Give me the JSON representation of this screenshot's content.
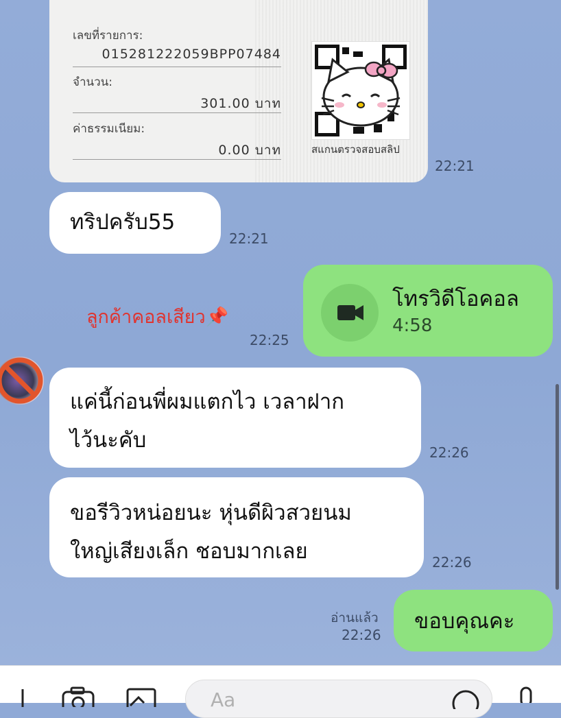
{
  "slip": {
    "ref_label": "เลขที่รายการ:",
    "ref_value": "015281222059BPP07484",
    "amount_label": "จำนวน:",
    "amount_value": "301.00 บาท",
    "fee_label": "ค่าธรรมเนียม:",
    "fee_value": "0.00 บาท",
    "qr_caption": "สแกนตรวจสอบสลิป",
    "time": "22:21"
  },
  "messages": [
    {
      "side": "left",
      "text": "ทริปครับ55",
      "time": "22:21"
    },
    {
      "side": "right",
      "type": "video-call",
      "title": "โทรวิดีโอคอล",
      "duration": "4:58",
      "time": "22:25"
    },
    {
      "side": "left",
      "text_line1": "แค่นี้ก่อนพี่ผมแตกไว เวลาฝาก",
      "text_line2": "ไว้นะคับ",
      "time": "22:26"
    },
    {
      "side": "left",
      "text_line1": "ขอรีวิวหน่อยนะ หุ่นดีผิวสวยนม",
      "text_line2": "ใหญ่เสียงเล็ก ชอบมากเลย",
      "time": "22:26"
    },
    {
      "side": "right",
      "text": "ขอบคุณคะ",
      "read": "อ่านแล้ว",
      "time": "22:26"
    }
  ],
  "annotation": "ลูกค้าคอลเสียว📌",
  "input": {
    "placeholder": "Aa"
  },
  "colors": {
    "background": "#8fa9d6",
    "sent_bubble": "#8ee27f",
    "received_bubble": "#ffffff",
    "annotation": "#e0342f"
  }
}
